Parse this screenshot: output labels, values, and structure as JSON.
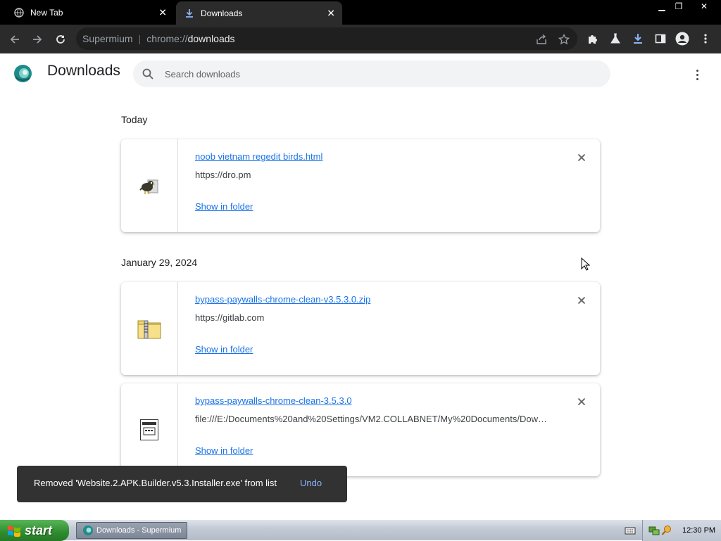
{
  "browser": {
    "tabs": [
      {
        "label": "New Tab",
        "icon": "globe-icon",
        "active": false
      },
      {
        "label": "Downloads",
        "icon": "download-icon",
        "active": true
      }
    ],
    "omnibox": {
      "site_label": "Supermium",
      "separator": "|",
      "url_scheme": "chrome://",
      "url_path": "downloads"
    },
    "colors": {
      "tabstrip": "#000000",
      "toolbar": "#2b2b2b",
      "download_accent": "#1a73e8"
    }
  },
  "page": {
    "title": "Downloads",
    "search": {
      "placeholder": "Search downloads",
      "value": ""
    }
  },
  "sections": [
    {
      "label": "Today",
      "items": [
        {
          "filename": "noob vietnam regedit birds.html",
          "source": "https://dro.pm",
          "action": "Show in folder",
          "icon": "bird-html-icon"
        }
      ]
    },
    {
      "label": "January 29, 2024",
      "items": [
        {
          "filename": "bypass-paywalls-chrome-clean-v3.5.3.0.zip",
          "source": "https://gitlab.com",
          "action": "Show in folder",
          "icon": "zip-folder-icon"
        },
        {
          "filename": "bypass-paywalls-chrome-clean-3.5.3.0",
          "source": "file:///E:/Documents%20and%20Settings/VM2.COLLABNET/My%20Documents/Down...",
          "action": "Show in folder",
          "icon": "exe-file-icon"
        }
      ]
    }
  ],
  "toast": {
    "message": "Removed 'Website.2.APK.Builder.v5.3.Installer.exe' from list",
    "action": "Undo"
  },
  "taskbar": {
    "start_label": "start",
    "task_label": "Downloads - Supermium",
    "clock": "12:30 PM"
  }
}
